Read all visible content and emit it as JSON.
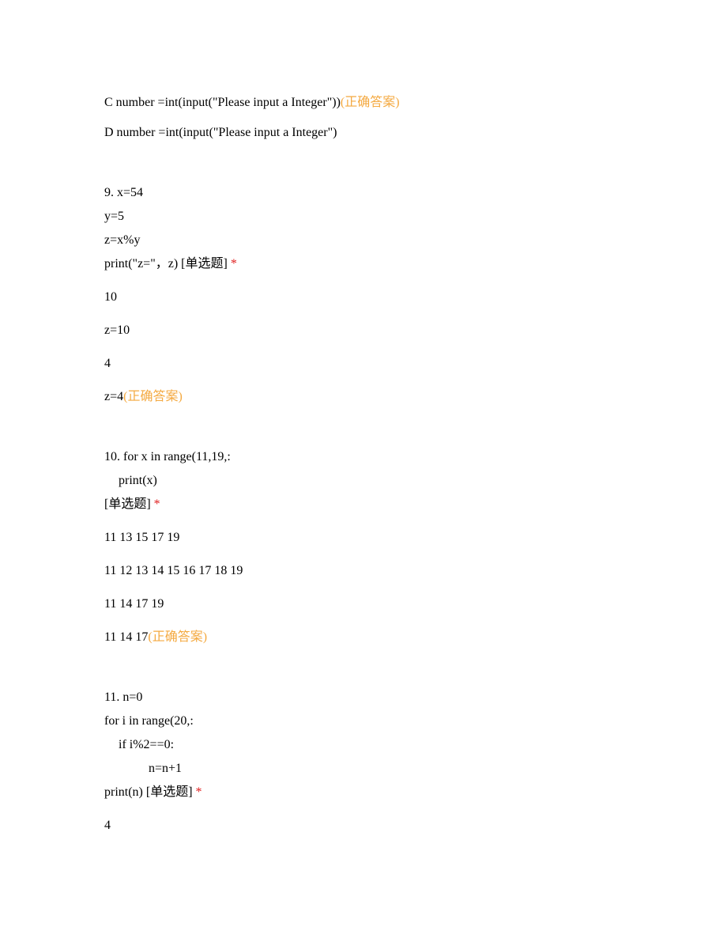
{
  "opt_c": {
    "text": "C number =int(input(\"Please input a Integer\"))",
    "correct": "(正确答案)"
  },
  "opt_d": {
    "text": "D number =int(input(\"Please input a Integer\")"
  },
  "q9": {
    "l1": "9. x=54",
    "l2": "y=5",
    "l3": "z=x%y",
    "l4": "print(\"z=\"，z) ",
    "tag": "[单选题] ",
    "star": "*",
    "a1": "10",
    "a2": "z=10",
    "a3": "4",
    "a4": "z=4",
    "correct": "(正确答案)"
  },
  "q10": {
    "l1": "10. for x in range(11,19,:",
    "l2": "print(x)",
    "tag": "[单选题] ",
    "star": "*",
    "a1": "11 13 15 17 19",
    "a2": "11 12 13 14 15 16 17 18 19",
    "a3": "11 14 17 19",
    "a4": "11 14 17",
    "correct": "(正确答案)"
  },
  "q11": {
    "l1": "11. n=0",
    "l2": "for i in range(20,:",
    "l3": "if i%2==0:",
    "l4": "n=n+1",
    "l5": "print(n) ",
    "tag": "[单选题] ",
    "star": "*",
    "a1": "4"
  }
}
